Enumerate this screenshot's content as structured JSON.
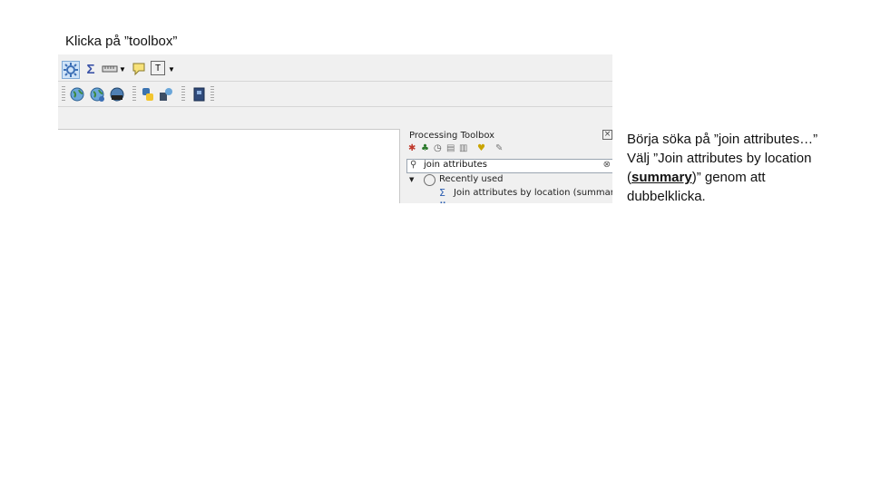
{
  "heading": "Klicka på ”toolbox”",
  "screenshot": {
    "toolbar1": {
      "icons": [
        "processing-toolbox-icon",
        "sum-icon",
        "measure-icon",
        "dropdown-arrow",
        "annotation-icon",
        "text-annotation-icon",
        "dropdown-arrow"
      ],
      "sigma": "Σ",
      "text_tool": "T"
    },
    "toolbar2": {
      "icons": [
        "add-layer-globe-icon",
        "add-wms-globe-icon",
        "add-vector-icon",
        "python-icon",
        "plugin-icon",
        "help-book-icon"
      ]
    },
    "panel": {
      "title": "Processing Toolbox",
      "search_value": "join attributes",
      "tree": {
        "group_label": "Recently used",
        "item_label": "Join attributes by location (summary)",
        "item_glyph": "Σ"
      }
    }
  },
  "instructions": {
    "line1": "Börja söka på ”join attributes…”",
    "line2": "Välj ”Join attributes by location",
    "line3_open": "(",
    "line3_bold": "summary",
    "line3_close": ")” genom att",
    "line4": "dubbelklicka."
  },
  "colors": {
    "toolbar_bg": "#f0f0f0",
    "canvas_bg": "#ffffff",
    "accent_blue": "#2a5db0"
  }
}
